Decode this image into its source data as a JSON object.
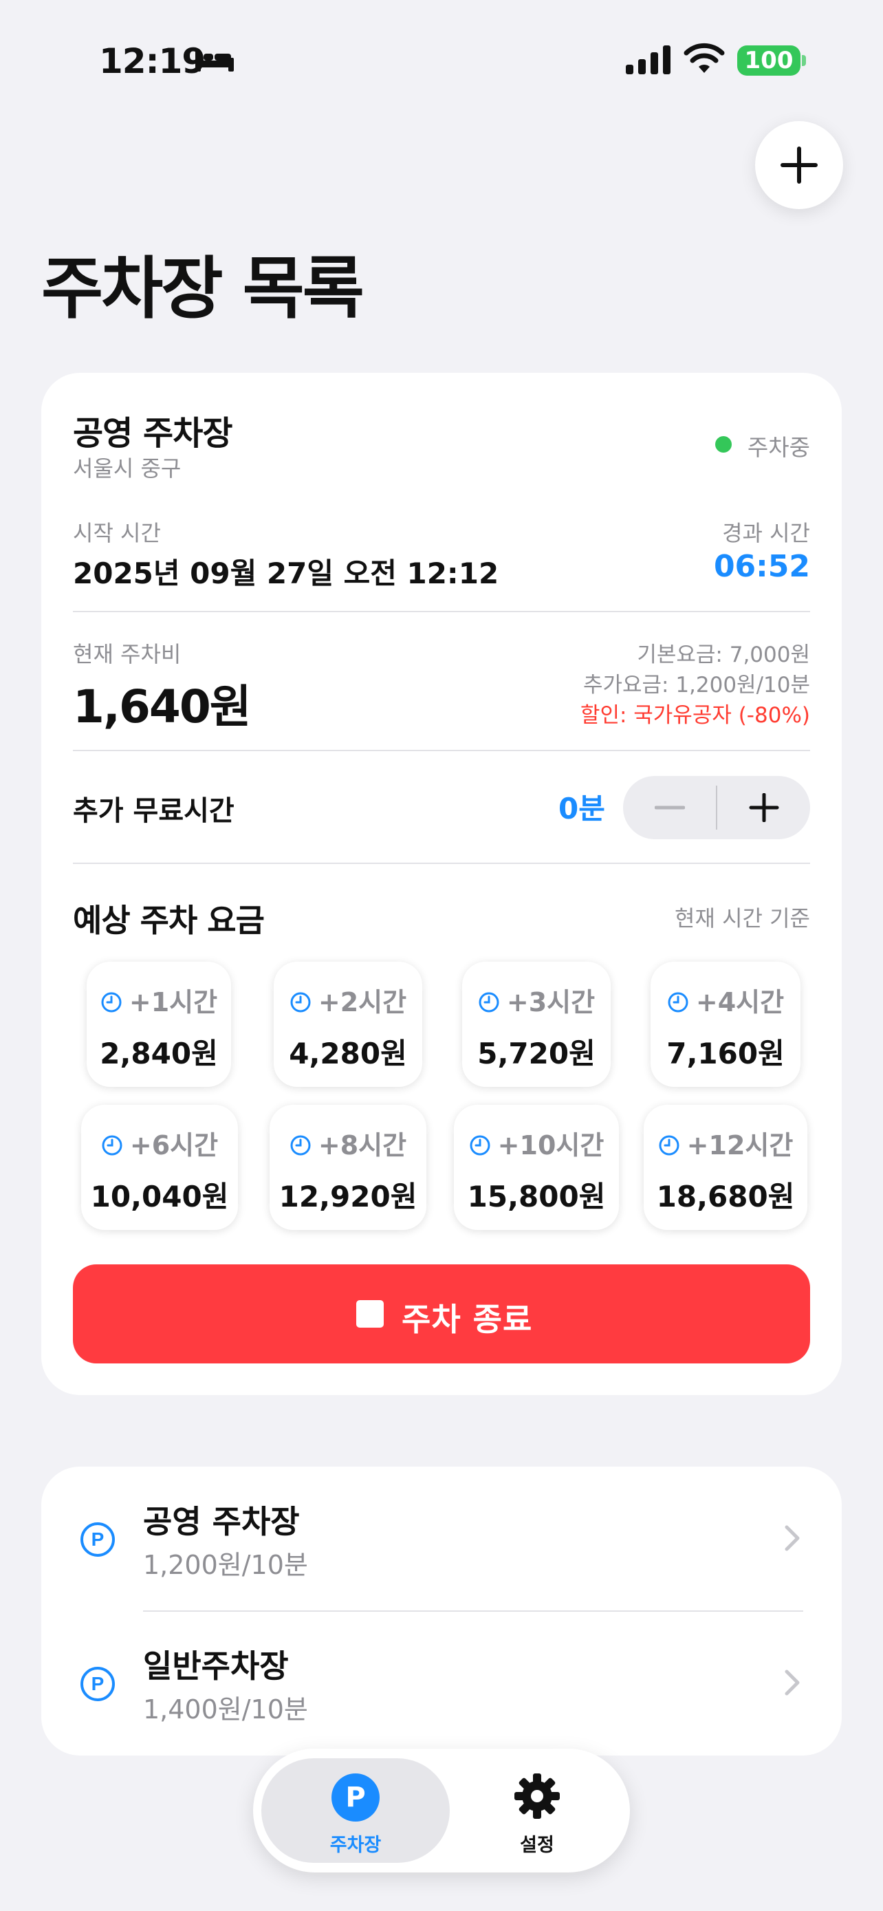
{
  "status_bar": {
    "time": "12:19",
    "battery": "100"
  },
  "header": {
    "title": "주차장 목록"
  },
  "active": {
    "name": "공영 주차장",
    "area": "서울시 중구",
    "status": "주차중",
    "start_label": "시작 시간",
    "start_value": "2025년 09월 27일 오전 12:12",
    "elapsed_label": "경과 시간",
    "elapsed_value": "06:52",
    "fee_label": "현재 주차비",
    "fee_value": "1,640원",
    "base_fee": "기본요금: 7,000원",
    "extra_fee": "추가요금: 1,200원/10분",
    "discount": "할인: 국가유공자 (-80%)",
    "free_label": "추가 무료시간",
    "free_value": "0분",
    "estimate_title": "예상 주차 요금",
    "estimate_note": "현재 시간 기준",
    "estimates": [
      {
        "label": "+1시간",
        "price": "2,840원"
      },
      {
        "label": "+2시간",
        "price": "4,280원"
      },
      {
        "label": "+3시간",
        "price": "5,720원"
      },
      {
        "label": "+4시간",
        "price": "7,160원"
      },
      {
        "label": "+6시간",
        "price": "10,040원"
      },
      {
        "label": "+8시간",
        "price": "12,920원"
      },
      {
        "label": "+10시간",
        "price": "15,800원"
      },
      {
        "label": "+12시간",
        "price": "18,680원"
      }
    ],
    "end_button": "주차 종료"
  },
  "lots": [
    {
      "name": "공영 주차장",
      "rate": "1,200원/10분"
    },
    {
      "name": "일반주차장",
      "rate": "1,400원/10분"
    }
  ],
  "tab_bar": {
    "parking_icon_letter": "P",
    "parking_label": "주차장",
    "settings_label": "설정"
  },
  "colors": {
    "accent": "#1a8cff",
    "danger": "#ff3b40",
    "status_active": "#34c759",
    "background": "#f2f2f6"
  },
  "icons": [
    "bed-icon",
    "signal-icon",
    "wifi-icon",
    "battery-icon",
    "plus-icon",
    "minus-icon",
    "clock-icon",
    "stop-icon",
    "parking-icon",
    "chevron-right-icon",
    "gear-icon"
  ]
}
